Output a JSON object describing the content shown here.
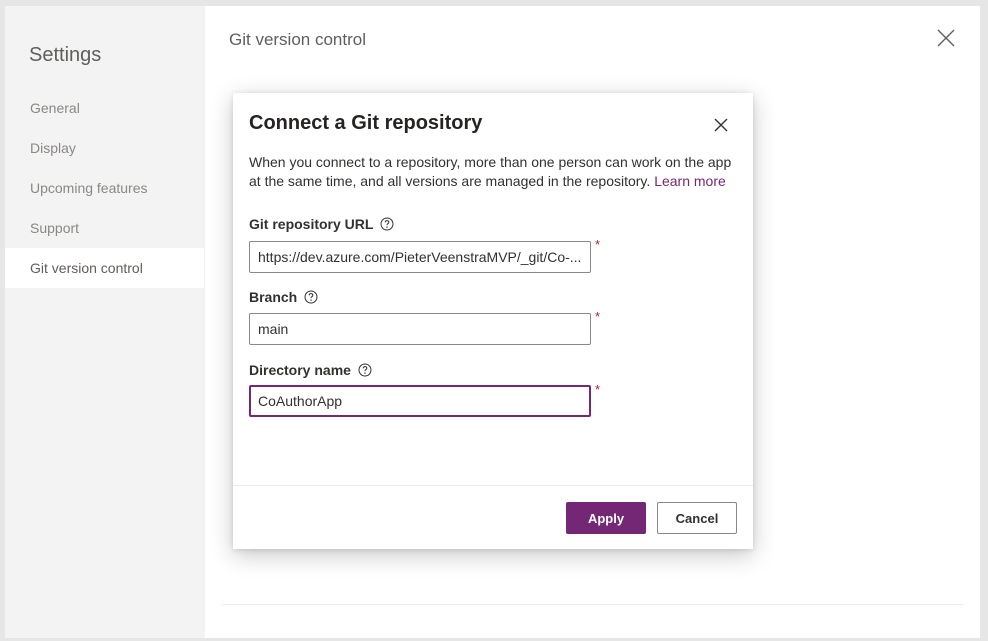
{
  "sidebar": {
    "title": "Settings",
    "items": [
      {
        "label": "General",
        "active": false
      },
      {
        "label": "Display",
        "active": false
      },
      {
        "label": "Upcoming features",
        "active": false
      },
      {
        "label": "Support",
        "active": false
      },
      {
        "label": "Git version control",
        "active": true
      }
    ]
  },
  "main": {
    "header": "Git version control"
  },
  "dialog": {
    "title": "Connect a Git repository",
    "description": "When you connect to a repository, more than one person can work on the app at the same time, and all versions are managed in the repository.",
    "learn_more": "Learn more",
    "fields": {
      "repo_url": {
        "label": "Git repository URL",
        "value": "https://dev.azure.com/PieterVeenstraMVP/_git/Co-...",
        "required": "*"
      },
      "branch": {
        "label": "Branch",
        "value": "main",
        "required": "*"
      },
      "directory": {
        "label": "Directory name",
        "value": "CoAuthorApp",
        "required": "*"
      }
    },
    "apply_label": "Apply",
    "cancel_label": "Cancel"
  },
  "colors": {
    "accent": "#742774",
    "required": "#a4262c",
    "sidebar_bg": "#f3f3f3"
  },
  "icons": {
    "panel_close": "close-icon",
    "dialog_close": "close-icon",
    "help": "help-circle-icon"
  }
}
